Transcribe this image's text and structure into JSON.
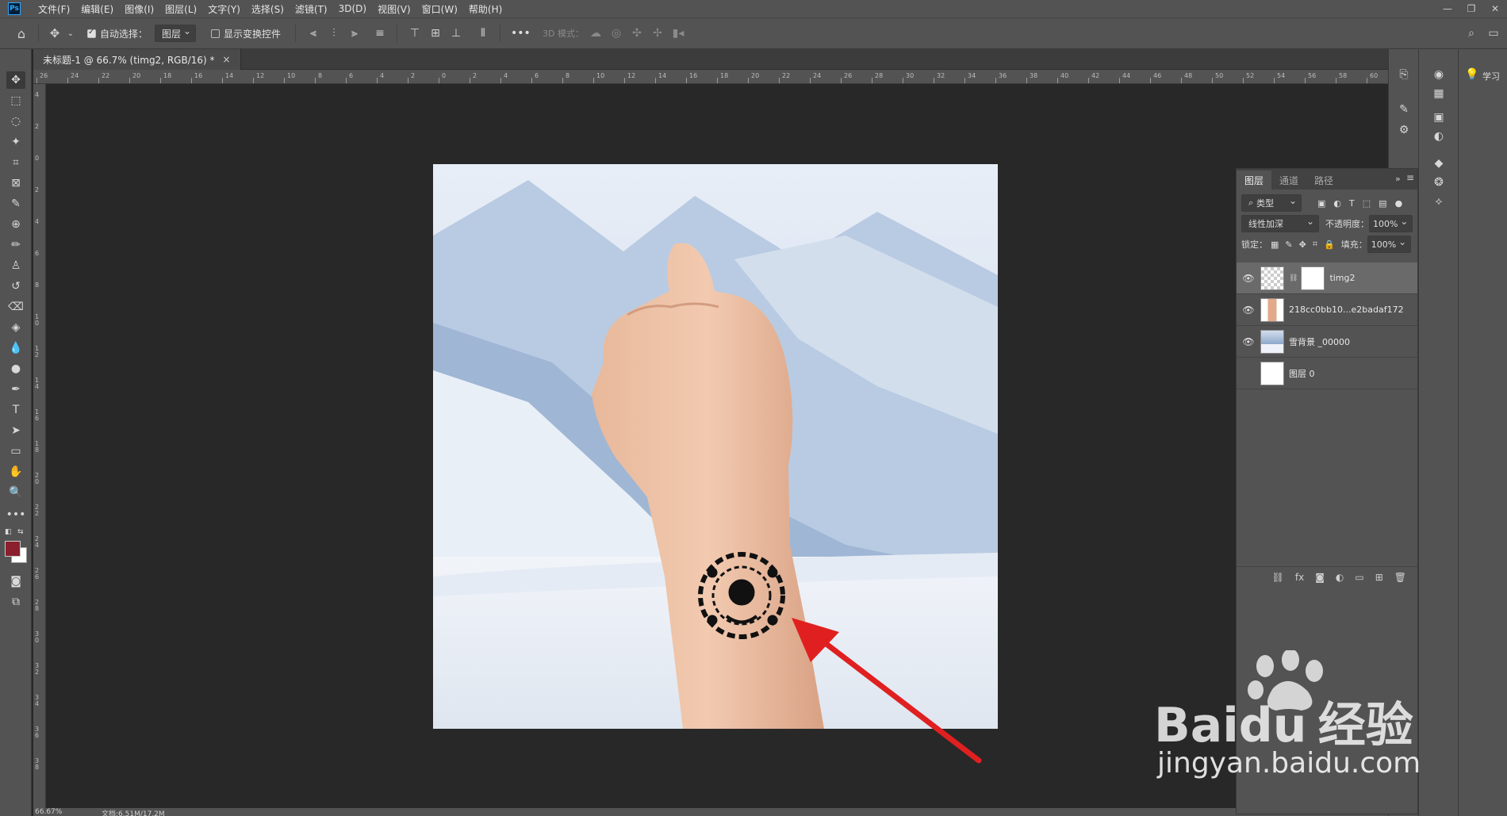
{
  "menu": {
    "items": [
      "文件(F)",
      "编辑(E)",
      "图像(I)",
      "图层(L)",
      "文字(Y)",
      "选择(S)",
      "滤镜(T)",
      "3D(D)",
      "视图(V)",
      "窗口(W)",
      "帮助(H)"
    ],
    "app_badge": "Ps"
  },
  "options": {
    "auto_select_label": "自动选择：",
    "auto_select_target": "图层",
    "show_transform_label": "显示变换控件",
    "mode3d_label": "3D 模式：",
    "more": "•••"
  },
  "document": {
    "tab_title": "未标题-1 @ 66.7% (timg2, RGB/16) *",
    "close": "×"
  },
  "ruler": {
    "top_ticks": [
      "26",
      "24",
      "22",
      "20",
      "18",
      "16",
      "14",
      "12",
      "10",
      "8",
      "6",
      "4",
      "2",
      "0",
      "2",
      "4",
      "6",
      "8",
      "10",
      "12",
      "14",
      "16",
      "18",
      "20",
      "22",
      "24",
      "26",
      "28",
      "30",
      "32",
      "34",
      "36",
      "38",
      "40",
      "42",
      "44",
      "46",
      "48",
      "50",
      "52",
      "54",
      "56",
      "58",
      "60",
      "62"
    ],
    "left_ticks": [
      "4",
      "2",
      "0",
      "2",
      "4",
      "6",
      "8",
      "1 0",
      "1 2",
      "1 4",
      "1 6",
      "1 8",
      "2 0",
      "2 2",
      "2 4",
      "2 6",
      "2 8",
      "3 0",
      "3 2",
      "3 4",
      "3 6",
      "3 8"
    ]
  },
  "status": {
    "zoom": "66.67%",
    "doc_size": "文档:6.51M/17.2M"
  },
  "layers_panel": {
    "tabs": [
      "图层",
      "通道",
      "路径"
    ],
    "filter_kind": "类型",
    "blend_mode": "线性加深",
    "opacity_label": "不透明度：",
    "opacity_value": "100%",
    "lock_label": "锁定：",
    "fill_label": "填充：",
    "fill_value": "100%",
    "layers": [
      {
        "name": "timg2",
        "visible": true,
        "selected": true
      },
      {
        "name": "218cc0bb10...e2badaf172",
        "visible": true,
        "selected": false
      },
      {
        "name": "雪背景 _00000",
        "visible": true,
        "selected": false
      },
      {
        "name": "图层 0",
        "visible": false,
        "selected": false
      }
    ]
  },
  "right_panel": {
    "learn_label": "学习"
  },
  "watermark": {
    "brand_baidu": "Bai",
    "brand_jingyan": "经验",
    "url": "jingyan.baidu.com"
  },
  "colors": {
    "ui_panel": "#535353",
    "canvas_bg": "#282828",
    "foreground": "#8b1f2e",
    "background": "#ffffff",
    "arrow": "#e02020"
  }
}
